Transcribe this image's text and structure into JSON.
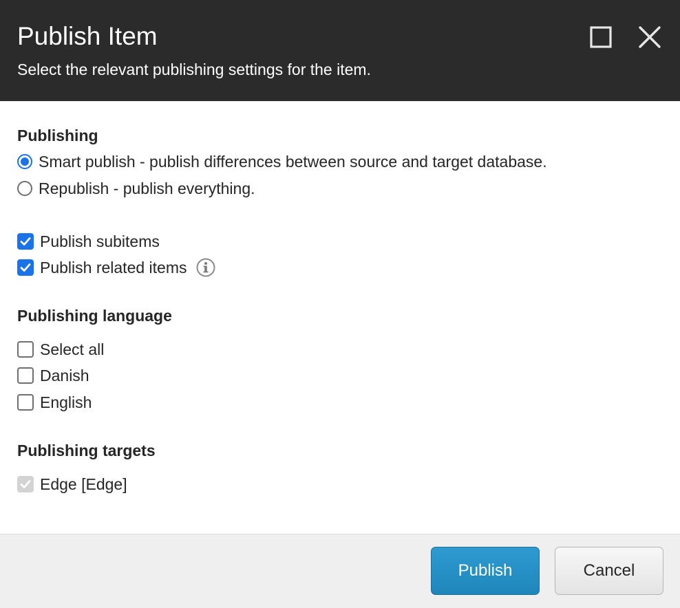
{
  "header": {
    "title": "Publish Item",
    "subtitle": "Select the relevant publishing settings for the item."
  },
  "publishing": {
    "title": "Publishing",
    "mode_options": [
      {
        "label": "Smart publish - publish differences between source and target database.",
        "checked": true
      },
      {
        "label": "Republish - publish everything.",
        "checked": false
      }
    ],
    "subitems": {
      "label": "Publish subitems",
      "checked": true
    },
    "related_items": {
      "label": "Publish related items",
      "checked": true
    }
  },
  "language": {
    "title": "Publishing language",
    "options": [
      {
        "label": "Select all",
        "checked": false
      },
      {
        "label": "Danish",
        "checked": false
      },
      {
        "label": "English",
        "checked": false
      }
    ]
  },
  "targets": {
    "title": "Publishing targets",
    "options": [
      {
        "label": "Edge [Edge]",
        "checked": true,
        "disabled": true
      }
    ]
  },
  "footer": {
    "publish_label": "Publish",
    "cancel_label": "Cancel"
  },
  "colors": {
    "header_bg": "#2b2b2b",
    "accent": "#1a73e8",
    "primary_button": "#2191c6",
    "footer_bg": "#efefef"
  },
  "icons": {
    "maximize": "maximize-icon",
    "close": "close-icon",
    "info": "info-icon",
    "check": "check-icon"
  }
}
